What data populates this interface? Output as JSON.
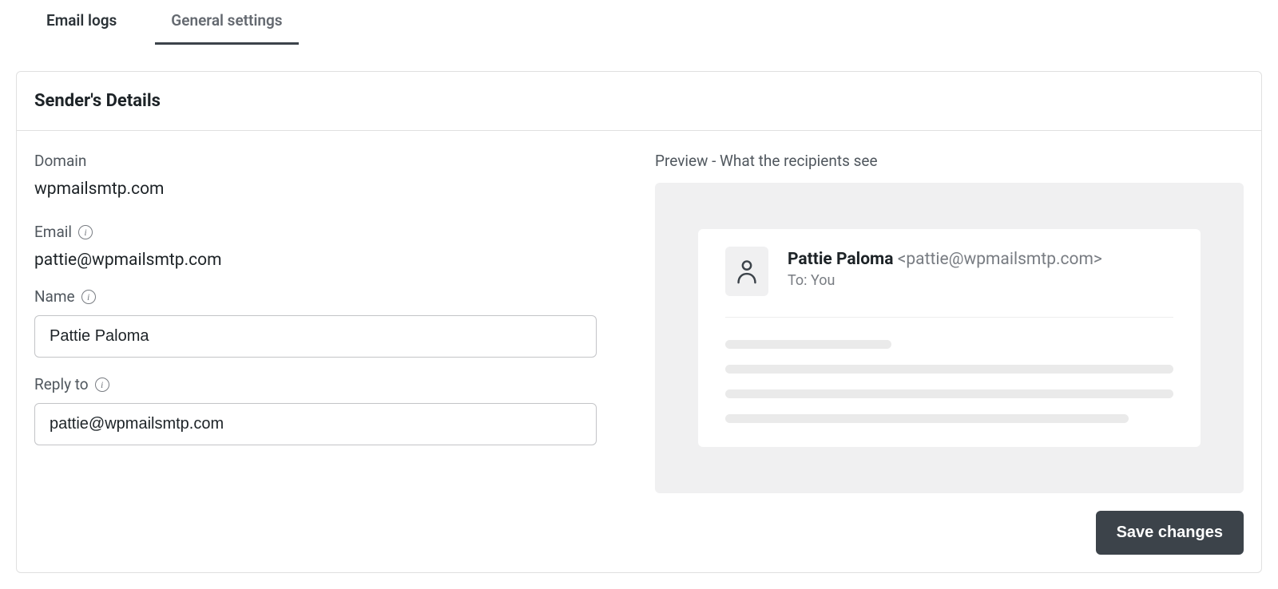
{
  "tabs": {
    "email_logs": "Email logs",
    "general_settings": "General settings"
  },
  "card": {
    "title": "Sender's Details",
    "domain_label": "Domain",
    "domain_value": "wpmailsmtp.com",
    "email_label": "Email",
    "email_value": "pattie@wpmailsmtp.com",
    "name_label": "Name",
    "name_value": "Pattie Paloma",
    "reply_to_label": "Reply to",
    "reply_to_value": "pattie@wpmailsmtp.com"
  },
  "preview": {
    "label": "Preview - What the recipients see",
    "sender_name": "Pattie Paloma",
    "sender_email": "<pattie@wpmailsmtp.com>",
    "to_line": "To: You"
  },
  "actions": {
    "save": "Save changes"
  },
  "info_glyph": "i"
}
